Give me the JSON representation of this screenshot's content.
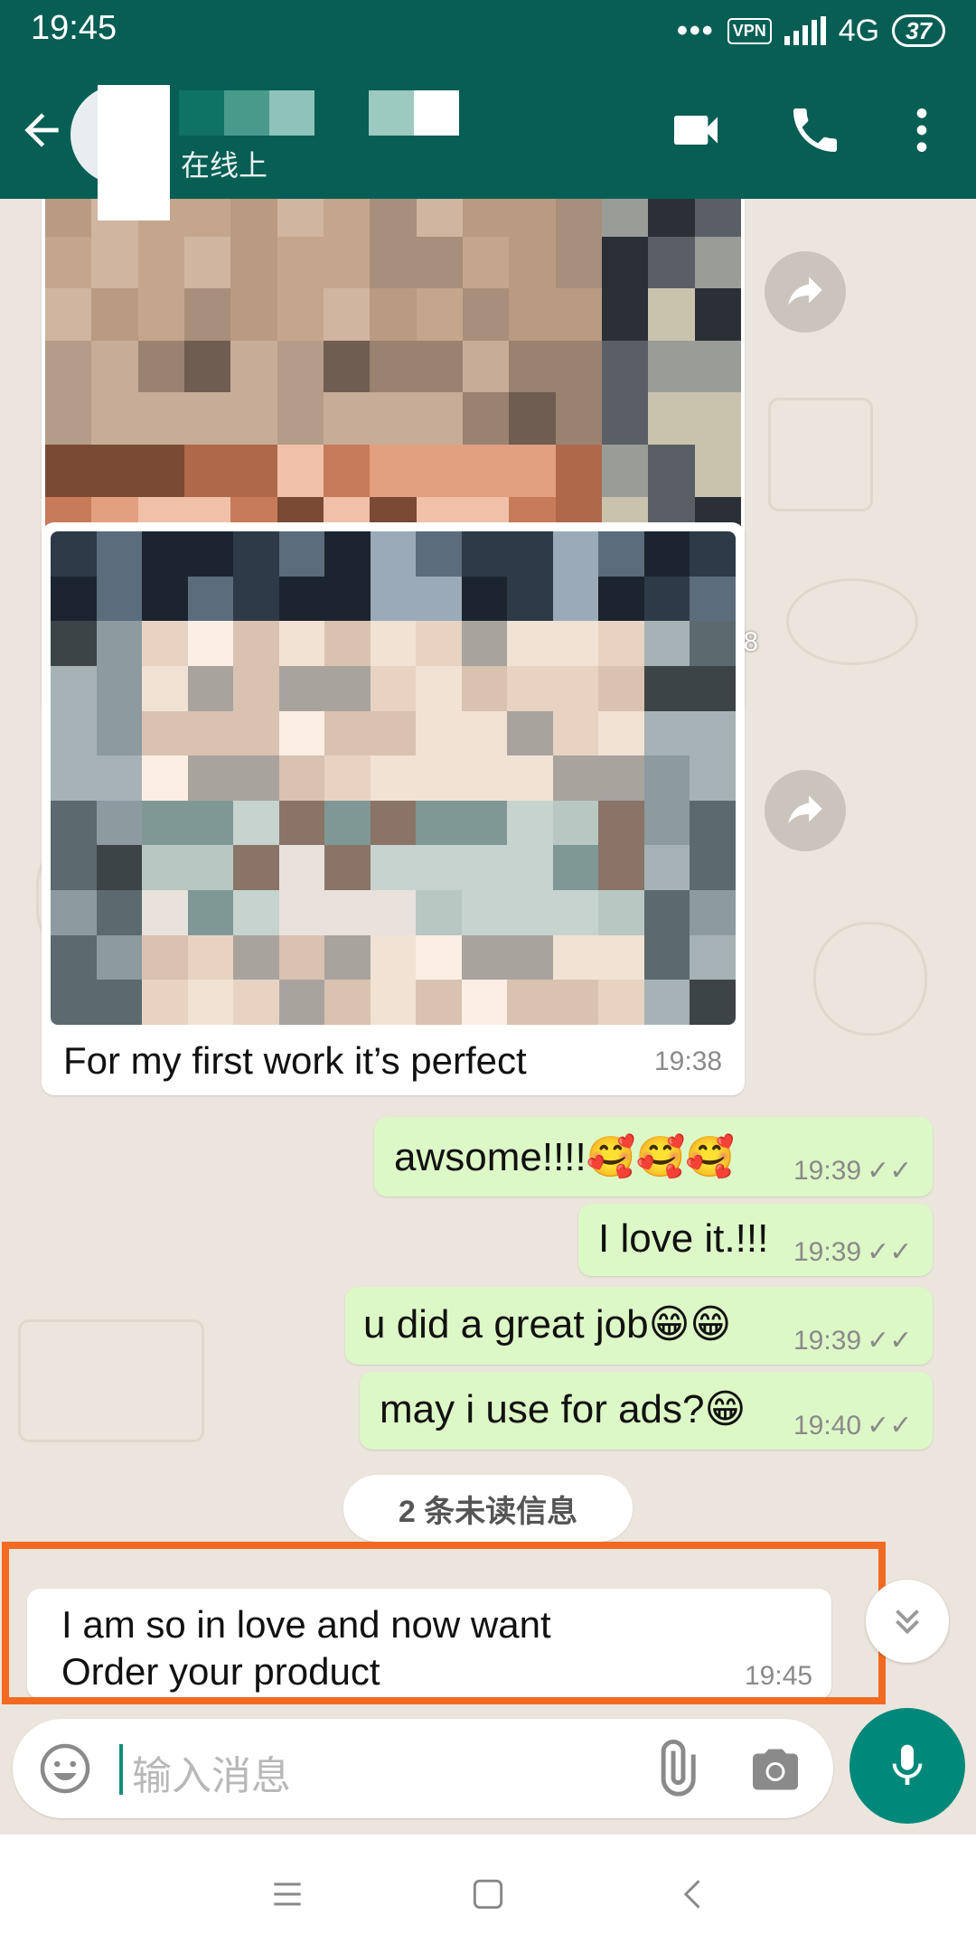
{
  "status_bar": {
    "time": "19:45",
    "vpn_label": "VPN",
    "network": "4G",
    "battery": "37"
  },
  "header": {
    "presence": "在线上"
  },
  "messages": [
    {
      "id": "img1",
      "direction": "incoming",
      "type": "image",
      "time": "19:38"
    },
    {
      "id": "img2",
      "direction": "incoming",
      "type": "image",
      "caption": "For my first work it’s perfect",
      "time": "19:38"
    },
    {
      "id": "m1",
      "direction": "outgoing",
      "text": "awsome!!!!🥰🥰🥰",
      "time": "19:39",
      "status": "read"
    },
    {
      "id": "m2",
      "direction": "outgoing",
      "text": "I love it.!!!",
      "time": "19:39",
      "status": "read"
    },
    {
      "id": "m3",
      "direction": "outgoing",
      "text": "u did a great job😁😁",
      "time": "19:39",
      "status": "read"
    },
    {
      "id": "m4",
      "direction": "outgoing",
      "text": "may i use for ads?😁",
      "time": "19:40",
      "status": "read"
    },
    {
      "id": "m5",
      "direction": "incoming",
      "text": "I am so in love and now want Order your product",
      "time": "19:45"
    }
  ],
  "unread_divider": "2 条未读信息",
  "composer": {
    "placeholder": "输入消息"
  },
  "icons": {
    "back": "arrow-left-icon",
    "video": "video-call-icon",
    "phone": "voice-call-icon",
    "more": "more-vert-icon",
    "forward": "forward-share-icon",
    "emoji": "emoji-icon",
    "attach": "paperclip-icon",
    "camera": "camera-icon",
    "mic": "mic-icon",
    "scroll_down": "double-chevron-down-icon"
  },
  "colors": {
    "header": "#075e54",
    "outgoing_bubble": "#dcf8c6",
    "incoming_bubble": "#ffffff",
    "chat_background": "#ece5dd",
    "mic_button": "#00897b",
    "highlight_box": "#f26a21"
  }
}
